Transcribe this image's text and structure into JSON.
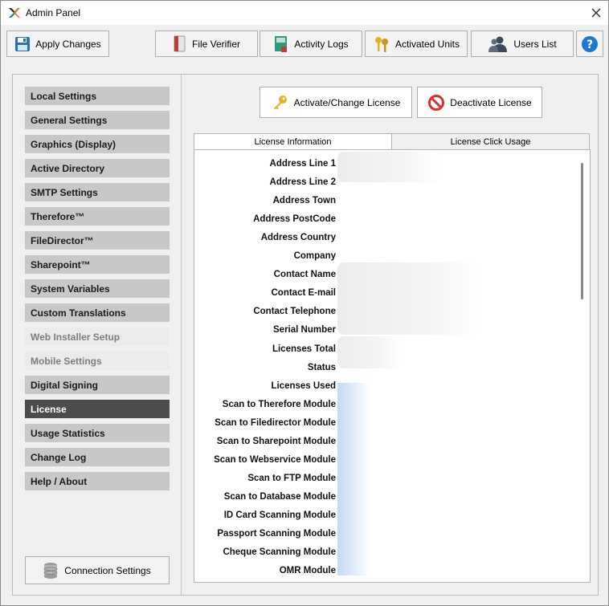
{
  "window": {
    "title": "Admin Panel"
  },
  "toolbar": {
    "apply_label": "Apply Changes",
    "file_verifier_label": "File Verifier",
    "activity_logs_label": "Activity Logs",
    "activated_units_label": "Activated Units",
    "users_list_label": "Users List"
  },
  "sidebar": {
    "items": [
      {
        "label": "Local Settings",
        "state": "normal"
      },
      {
        "label": "General Settings",
        "state": "normal"
      },
      {
        "label": "Graphics (Display)",
        "state": "normal"
      },
      {
        "label": "Active Directory",
        "state": "normal"
      },
      {
        "label": "SMTP Settings",
        "state": "normal"
      },
      {
        "label": "Therefore™",
        "state": "normal"
      },
      {
        "label": "FileDirector™",
        "state": "normal"
      },
      {
        "label": "Sharepoint™",
        "state": "normal"
      },
      {
        "label": "System Variables",
        "state": "normal"
      },
      {
        "label": "Custom Translations",
        "state": "normal"
      },
      {
        "label": "Web Installer Setup",
        "state": "disabled"
      },
      {
        "label": "Mobile Settings",
        "state": "disabled"
      },
      {
        "label": "Digital Signing",
        "state": "normal"
      },
      {
        "label": "License",
        "state": "active"
      },
      {
        "label": "Usage Statistics",
        "state": "normal"
      },
      {
        "label": "Change Log",
        "state": "normal"
      },
      {
        "label": "Help / About",
        "state": "normal"
      }
    ],
    "connection_settings_label": "Connection Settings"
  },
  "license": {
    "activate_label": "Activate/Change License",
    "deactivate_label": "Deactivate License",
    "tabs": [
      "License Information",
      "License Click Usage"
    ],
    "fields": [
      "Address Line 1",
      "Address Line 2",
      "Address Town",
      "Address PostCode",
      "Address Country",
      "Company",
      "Contact Name",
      "Contact E-mail",
      "Contact Telephone",
      "Serial Number",
      "Licenses Total",
      "Status",
      "Licenses Used",
      "Scan to Therefore Module",
      "Scan to Filedirector Module",
      "Scan to Sharepoint Module",
      "Scan to Webservice Module",
      "Scan to FTP Module",
      "Scan to Database Module",
      "ID Card Scanning Module",
      "Passport Scanning Module",
      "Cheque Scanning Module",
      "OMR Module"
    ]
  },
  "colors": {
    "active_menu": "#4c4c4c",
    "menu_bg": "#c8c8c8",
    "disabled_menu_bg": "#ebebeb",
    "help_blue": "#1e78d2"
  }
}
